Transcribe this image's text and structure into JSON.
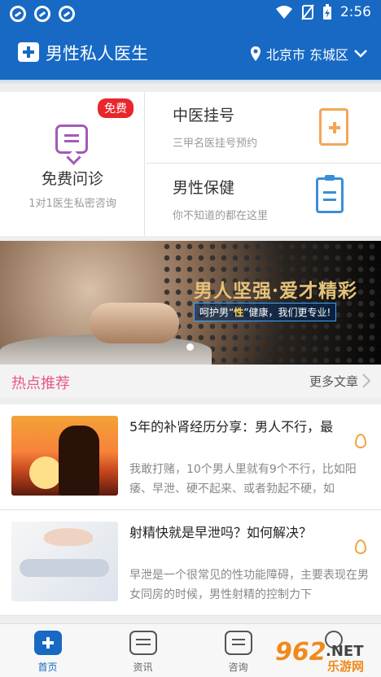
{
  "status_bar": {
    "time": "2:56"
  },
  "app_bar": {
    "title": "男性私人医生",
    "location": "北京市 东城区"
  },
  "services": {
    "consult": {
      "badge": "免费",
      "title": "免费问诊",
      "subtitle": "1对1医生私密咨询"
    },
    "registration": {
      "title": "中医挂号",
      "subtitle": "三甲名医挂号预约"
    },
    "health": {
      "title": "男性保健",
      "subtitle": "你不知道的都在这里"
    }
  },
  "banner": {
    "headline": "男人坚强·爱才精彩",
    "tagline_pre": "呵护男“",
    "tagline_mid": "性",
    "tagline_post": "”健康，我们更专业!"
  },
  "hot": {
    "title": "热点推荐",
    "more": "更多文章"
  },
  "articles": [
    {
      "title": "5年的补肾经历分享：男人不行，最",
      "excerpt": "我敢打赌，10个男人里就有9个不行，比如阳痿、早泄、硬不起来、或者勃起不硬，如"
    },
    {
      "title": "射精快就是早泄吗？如何解决？",
      "excerpt": "早泄是一个很常见的性功能障碍，主要表现在男女同房的时候，男性射精的控制力下"
    }
  ],
  "tabs": [
    {
      "label": "首页",
      "icon": "home-icon"
    },
    {
      "label": "资讯",
      "icon": "news-icon"
    },
    {
      "label": "咨询",
      "icon": "chat-icon"
    },
    {
      "label": "",
      "icon": "person-icon"
    }
  ],
  "watermark": {
    "brand": "962",
    "suffix": ".NET",
    "cn": "乐游网"
  },
  "colors": {
    "primary": "#1769c4",
    "hot": "#e8578a",
    "badge": "#e8262b",
    "watermark": "#f08a1c"
  }
}
